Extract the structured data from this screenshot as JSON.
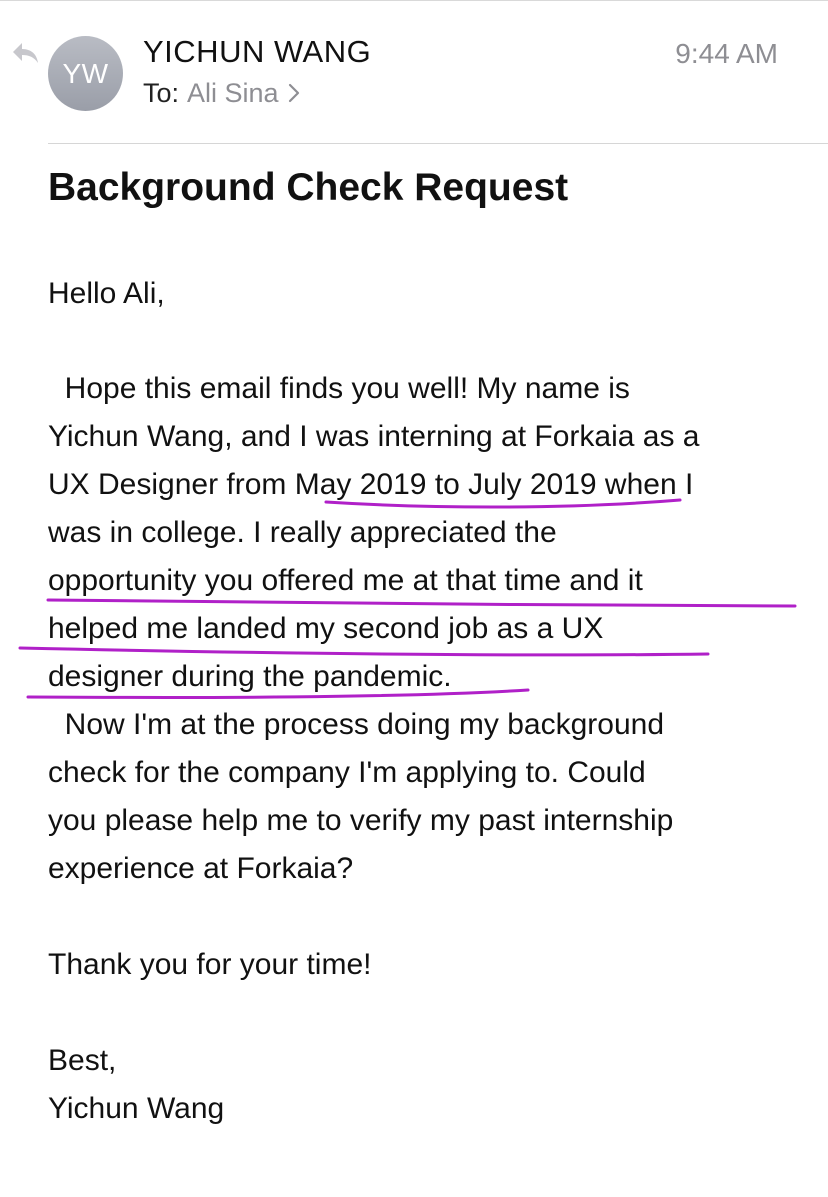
{
  "header": {
    "avatar_initials": "YW",
    "sender": "YICHUN WANG",
    "to_label": "To:",
    "to_name": "Ali Sina",
    "time": "9:44 AM"
  },
  "subject": "Background Check Request",
  "body": {
    "greeting": "Hello Ali,",
    "paragraph1_lines": [
      "  Hope this email finds you well! My name is",
      "Yichun Wang, and I was interning at Forkaia as a",
      "UX Designer from May 2019 to July 2019 when I",
      "was in college. I really appreciated the",
      "opportunity you offered me at that time and it",
      "helped me landed my second job as a UX",
      "designer during the pandemic."
    ],
    "paragraph2_lines": [
      "  Now I'm at the process doing my background",
      "check for the company I'm applying to. Could",
      "you please help me to verify my past internship",
      "experience at Forkaia?"
    ],
    "thanks": "Thank you for your time!",
    "signoff": "Best,",
    "signature": "Yichun Wang"
  },
  "colors": {
    "annotation": "#b020c8",
    "muted": "#8e8e93",
    "avatar": "#a9adb5"
  },
  "icons": {
    "reply": "reply-arrow-icon",
    "chevron": "chevron-right-icon"
  }
}
